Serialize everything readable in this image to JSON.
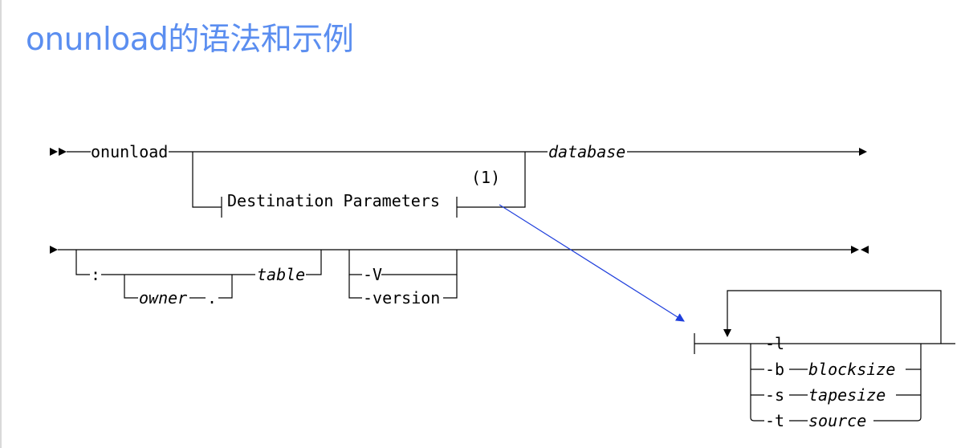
{
  "title": "onunload的语法和示例",
  "diagram": {
    "command": "onunload",
    "database": "database",
    "destination_parameters": "Destination Parameters",
    "footnote_ref": "(1)",
    "colon": ":",
    "owner": "owner",
    "dot": ".",
    "table": "table",
    "opt_V": "-V",
    "opt_version": "-version",
    "params": [
      {
        "flag": "-l",
        "arg": ""
      },
      {
        "flag": "-b",
        "arg": "blocksize"
      },
      {
        "flag": "-s",
        "arg": "tapesize"
      },
      {
        "flag": "-t",
        "arg": "source"
      }
    ],
    "arrow_color": "#1f3fdc"
  }
}
